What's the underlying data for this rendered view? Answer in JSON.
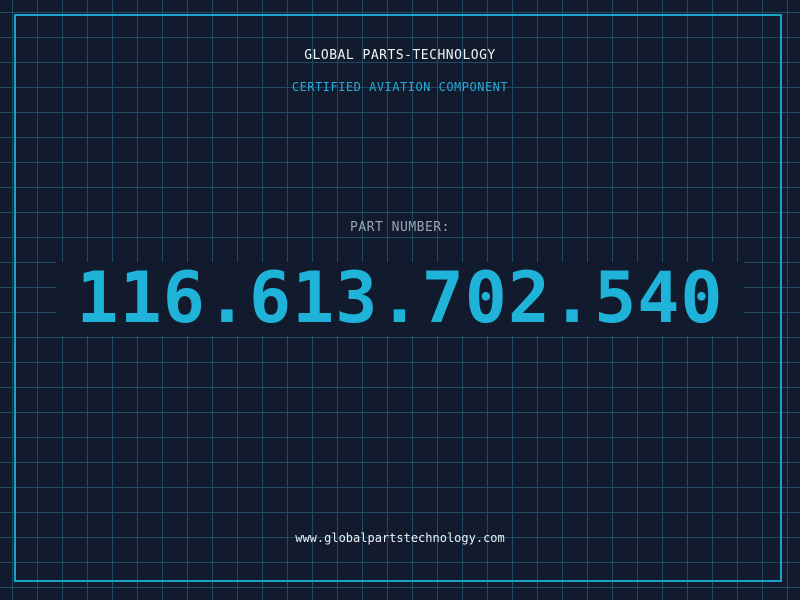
{
  "header": {
    "company": "GLOBAL PARTS-TECHNOLOGY",
    "tagline": "CERTIFIED AVIATION COMPONENT"
  },
  "part": {
    "label": "PART NUMBER:",
    "number": "116.613.702.540"
  },
  "footer": {
    "website": "www.globalpartstechnology.com"
  },
  "colors": {
    "background": "#131b2e",
    "grid": "#1f4a63",
    "accent": "#1fb3d9",
    "frame": "#1aa3c8"
  }
}
